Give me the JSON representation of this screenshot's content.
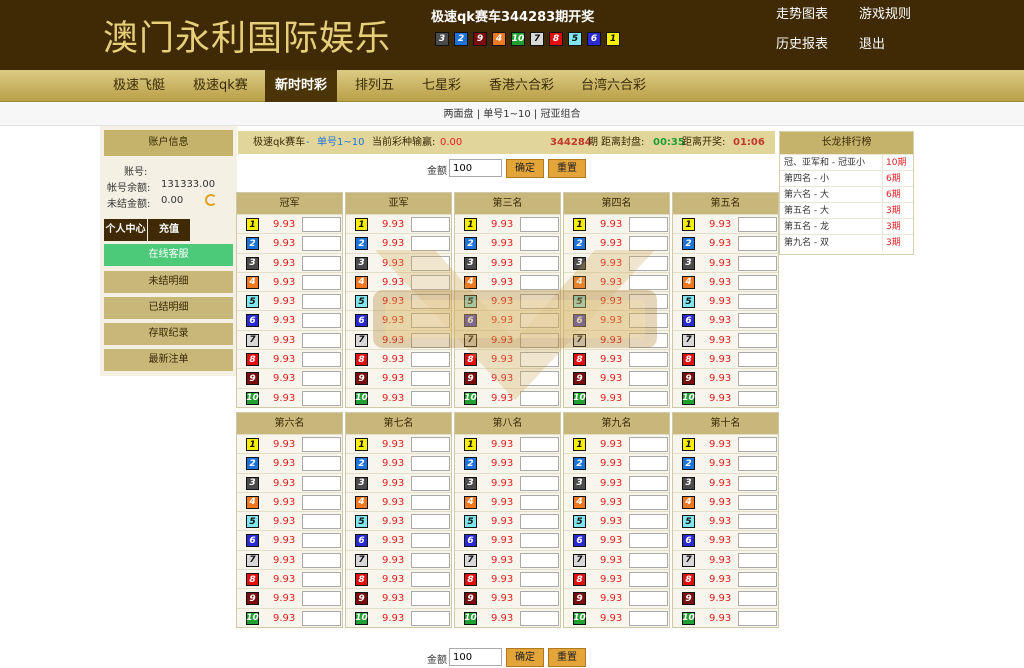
{
  "header": {
    "site_title": "澳门永利国际娱乐",
    "draw_title": "极速qk赛车344283期开奖",
    "draw_numbers": [
      "3",
      "2",
      "9",
      "4",
      "10",
      "7",
      "8",
      "5",
      "6",
      "1"
    ],
    "links": [
      "走势图表",
      "游戏规则",
      "历史报表",
      "退出"
    ]
  },
  "nav": [
    "极速飞艇",
    "极速qk赛",
    "新时时彩",
    "排列五",
    "七星彩",
    "香港六合彩",
    "台湾六合彩"
  ],
  "subnav": "两面盘 | 单号1~10 | 冠亚组合",
  "account": {
    "head": "账户信息",
    "account_label": "账号:",
    "balance_label": "帐号余额:",
    "balance_value": "131333.00",
    "unsettled_label": "未结金额:",
    "unsettled_value": "0.00",
    "personal_btn": "个人中心",
    "recharge_btn": "充值",
    "menu": [
      "在线客服",
      "未结明细",
      "已结明细",
      "存取纪录",
      "最新注单"
    ]
  },
  "topbar": {
    "game": "极速qk赛车",
    "dash": "-",
    "mode": "单号1~10",
    "profit_label": "当前彩种输赢:",
    "profit_value": "0.00",
    "period": "344284",
    "period_unit": "期",
    "close_label": "距离封盘:",
    "close_time": "00:35",
    "open_label": "距离开奖:",
    "open_time": "01:06"
  },
  "bet": {
    "amount_label": "金额",
    "amount_value": "100",
    "confirm": "确定",
    "reset": "重置",
    "odds": "9.93"
  },
  "columns": [
    "冠军",
    "亚军",
    "第三名",
    "第四名",
    "第五名",
    "第六名",
    "第七名",
    "第八名",
    "第九名",
    "第十名"
  ],
  "numbers": [
    "1",
    "2",
    "3",
    "4",
    "5",
    "6",
    "7",
    "8",
    "9",
    "10"
  ],
  "ranking": {
    "head": "长龙排行榜",
    "rows": [
      {
        "name": "冠、亚军和 - 冠亚小",
        "value": "10期"
      },
      {
        "name": "第四名 - 小",
        "value": "6期"
      },
      {
        "name": "第六名 - 大",
        "value": "6期"
      },
      {
        "name": "第五名 - 大",
        "value": "3期"
      },
      {
        "name": "第五名 - 龙",
        "value": "3期"
      },
      {
        "name": "第九名 - 双",
        "value": "3期"
      }
    ]
  },
  "colors": {
    "header_bg": "#3f2a05",
    "gold": "#c8b77a",
    "odds_red": "#e02020",
    "ball_colors": {
      "1": "#f6f000",
      "2": "#1e73d8",
      "3": "#4b4b4b",
      "4": "#f07820",
      "5": "#7fe6f0",
      "6": "#2a2ad0",
      "7": "#d8d8d8",
      "8": "#e01010",
      "9": "#7a0e0e",
      "10": "#1fa030"
    }
  }
}
